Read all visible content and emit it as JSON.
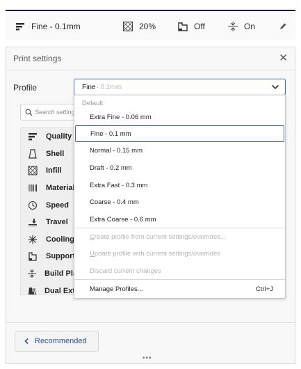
{
  "topbar": {
    "profile_label": "Fine - 0.1mm",
    "infill_label": "20%",
    "support_label": "Off",
    "adhesion_label": "On"
  },
  "panel": {
    "title": "Print settings",
    "profile_label": "Profile",
    "selected_profile_name": "Fine",
    "selected_profile_sub": " - 0.1mm",
    "search_placeholder": "Search settings",
    "categories": [
      {
        "label": "Quality",
        "icon": "quality-icon"
      },
      {
        "label": "Shell",
        "icon": "shell-icon"
      },
      {
        "label": "Infill",
        "icon": "infill-icon"
      },
      {
        "label": "Material",
        "icon": "material-icon"
      },
      {
        "label": "Speed",
        "icon": "speed-icon"
      },
      {
        "label": "Travel",
        "icon": "travel-icon"
      },
      {
        "label": "Cooling",
        "icon": "cooling-icon"
      },
      {
        "label": "Support",
        "icon": "support-icon"
      },
      {
        "label": "Build Plate Adhesion",
        "icon": "adhesion-icon"
      },
      {
        "label": "Dual Extrusion",
        "icon": "dual-extrusion-icon"
      }
    ],
    "recommended_label": "Recommended"
  },
  "dropdown": {
    "default_header": "Default",
    "profiles": [
      "Extra Fine - 0.06 mm",
      "Fine - 0.1 mm",
      "Normal - 0.15 mm",
      "Draft - 0.2 mm",
      "Extra Fast - 0.3 mm",
      "Coarse - 0.4 mm",
      "Extra Coarse - 0.6 mm"
    ],
    "selected_index": 1,
    "actions": {
      "create_first": "C",
      "create_rest": "reate profile from current settings/overrides...",
      "update_first": "U",
      "update_rest": "pdate profile with current settings/overrides",
      "discard": "Discard current changes"
    },
    "manage_label": "Manage Profiles...",
    "manage_shortcut": "Ctrl+J"
  },
  "colors": {
    "accent": "#3a64c8",
    "link": "#2b4f9e",
    "disabled": "#b5b5b5"
  }
}
